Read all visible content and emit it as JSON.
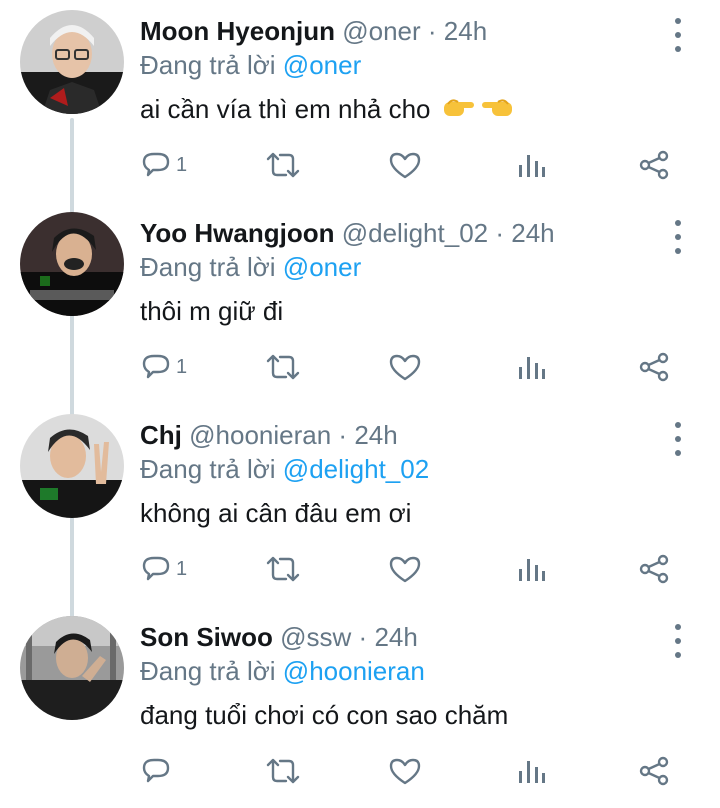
{
  "tweets": [
    {
      "name": "Moon Hyeonjun",
      "handle": "@oner",
      "separator": "·",
      "time": "24h",
      "replying_prefix": "Đang trả lời",
      "replying_to": "@oner",
      "text": "ai cần vía thì em nhả cho",
      "reply_count": "1",
      "emoji": [
        "backhand-index-pointing-right",
        "backhand-index-pointing-left"
      ]
    },
    {
      "name": "Yoo Hwangjoon",
      "handle": "@delight_02",
      "separator": "·",
      "time": "24h",
      "replying_prefix": "Đang trả lời",
      "replying_to": "@oner",
      "text": "thôi m giữ đi",
      "reply_count": "1"
    },
    {
      "name": "Chj",
      "handle": "@hoonieran",
      "separator": "·",
      "time": "24h",
      "replying_prefix": "Đang trả lời",
      "replying_to": "@delight_02",
      "text": "không ai cân đâu em ơi",
      "reply_count": "1"
    },
    {
      "name": "Son Siwoo",
      "handle": "@ssw",
      "separator": "·",
      "time": "24h",
      "replying_prefix": "Đang trả lời",
      "replying_to": "@hoonieran",
      "text": "đang tuổi chơi có con sao chăm",
      "reply_count": ""
    }
  ],
  "icons": {
    "reply": "reply-icon",
    "retweet": "retweet-icon",
    "like": "heart-icon",
    "views": "views-icon",
    "share": "share-icon",
    "more": "more-vertical-icon"
  },
  "colors": {
    "accent": "#1da1f2",
    "secondary_text": "#657786",
    "thread_line": "#cfd9de"
  }
}
